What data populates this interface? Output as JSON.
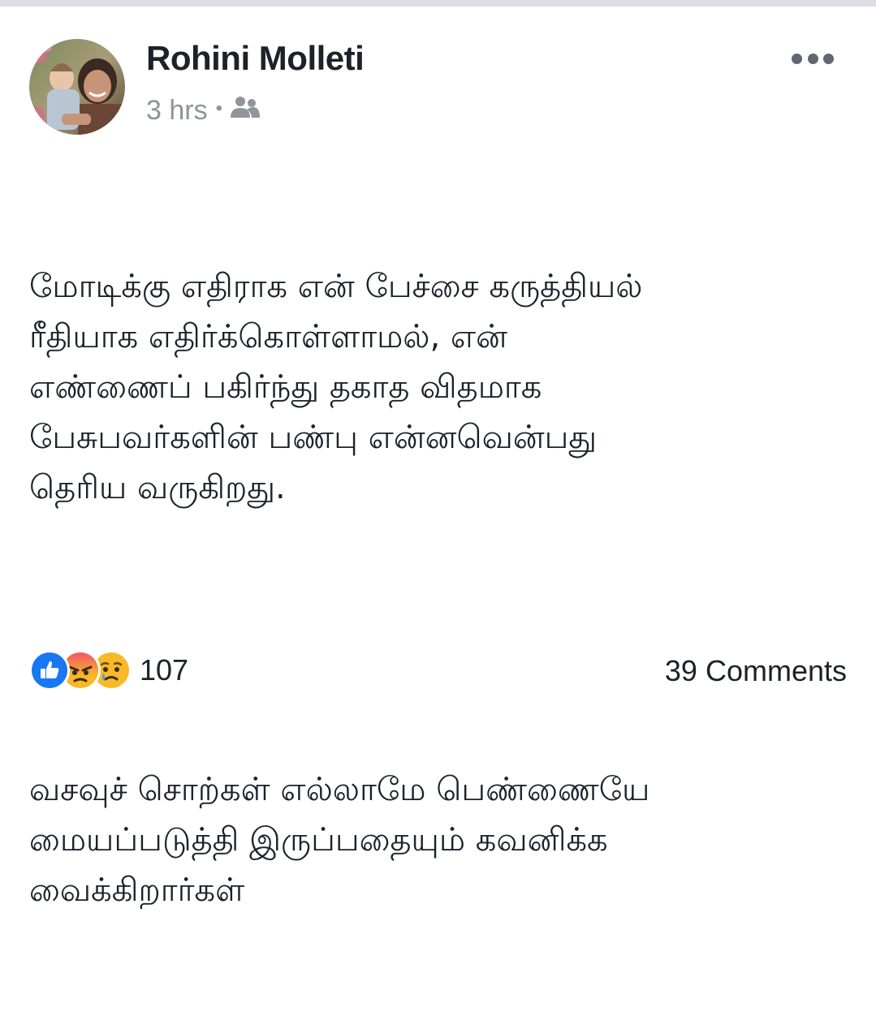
{
  "post": {
    "author": "Rohini Molleti",
    "time": "3 hrs",
    "separator": "•",
    "audience_icon": "friends-icon",
    "more_icon": "more-options-icon",
    "paragraphs": [
      "மோடிக்கு எதிராக என் பேச்சை கருத்தியல்\nரீதியாக எதிர்க்கொள்ளாமல், என்\nஎண்ணைப் பகிர்ந்து தகாத விதமாக\nபேசுபவர்களின் பண்பு என்னவென்பது\nதெரிய வருகிறது.",
      "வசவுச் சொற்கள் எல்லாமே பெண்ணையே\nமையப்படுத்தி இருப்பதையும் கவனிக்க\nவைக்கிறார்கள்"
    ]
  },
  "footer": {
    "reaction_icons": [
      "like-icon",
      "angry-icon",
      "sad-icon"
    ],
    "reaction_count": "107",
    "comments": "39 Comments"
  },
  "colors": {
    "like_blue": "#1877f2",
    "angry_red": "#f25268",
    "emoji_yellow": "#f7b928",
    "meta_gray": "#90949c"
  }
}
